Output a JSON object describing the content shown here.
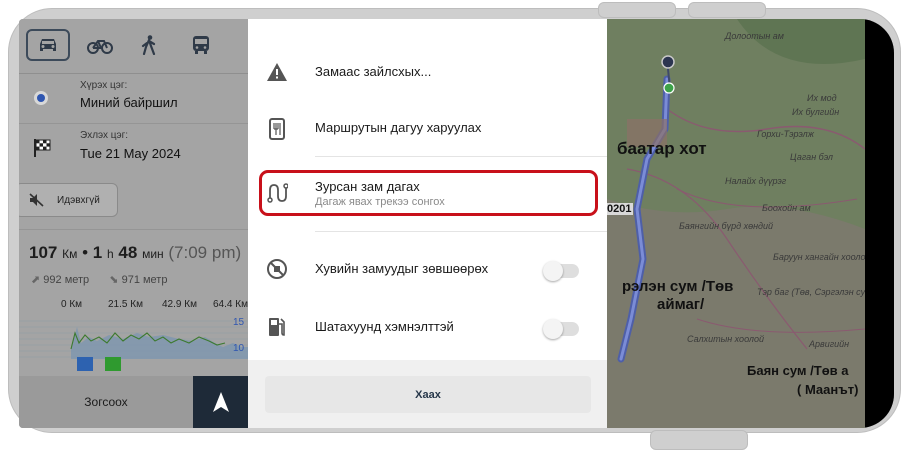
{
  "left_panel": {
    "transport_modes": [
      "car-icon",
      "bicycle-icon",
      "pedestrian-icon",
      "bus-icon"
    ],
    "destination_label": "Хүрэх цэг:",
    "destination_value": "Миний байршил",
    "start_label": "Эхлэх цэг:",
    "start_value": "Tue 21 May 2024",
    "mute_label": "Идэвхгүй",
    "distance_num": "107",
    "distance_unit": "Км",
    "separator": "•",
    "hours_num": "1",
    "hours_unit": "h",
    "minutes_num": "48",
    "minutes_unit": "мин",
    "arrival": "(7:09 pm)",
    "ascent": "992 метр",
    "descent": "971 метр",
    "distance_ticks": [
      "0 Км",
      "21.5 Км",
      "42.9 Км",
      "64.4 Км"
    ],
    "elev_scale": [
      "15",
      "10"
    ],
    "stop_button": "Зогсоох"
  },
  "menu": {
    "items": [
      {
        "label": "Замаас зайлсхых...",
        "icon": "warning-icon"
      },
      {
        "label": "Маршрутын дагуу харуулах",
        "icon": "poi-icon"
      },
      {
        "label": "Зурсан зам дагах",
        "sub": "Дагаж явах трекээ сонгох",
        "icon": "track-icon"
      },
      {
        "label": "Хувийн замуудыг зөвшөөрөх",
        "icon": "no-private-road-icon"
      },
      {
        "label": "Шатахуунд хэмнэлттэй",
        "icon": "fuel-icon"
      }
    ],
    "close_label": "Хаах"
  },
  "map": {
    "city": "баатар хот",
    "district1_line1": "рэлэн сум /Төв",
    "district1_line2": "аймаг/",
    "district2_line1": "Баян сум /Төв а",
    "district2_line2": "( Маанът)",
    "road": "0201",
    "places": [
      "Долоотын ам",
      "Их мод",
      "Их булгийн",
      "Горхи-Тэрэлж",
      "Цаган бэл",
      "Налайх дүүрэг",
      "Боохойн ам",
      "Баянгийн бүрд хөндий",
      "Баруун хангайн хоолой",
      "Тэр баг (Төв, Сэргэлэн сум)",
      "Салхитын хоолой",
      "Арвигийн"
    ]
  }
}
